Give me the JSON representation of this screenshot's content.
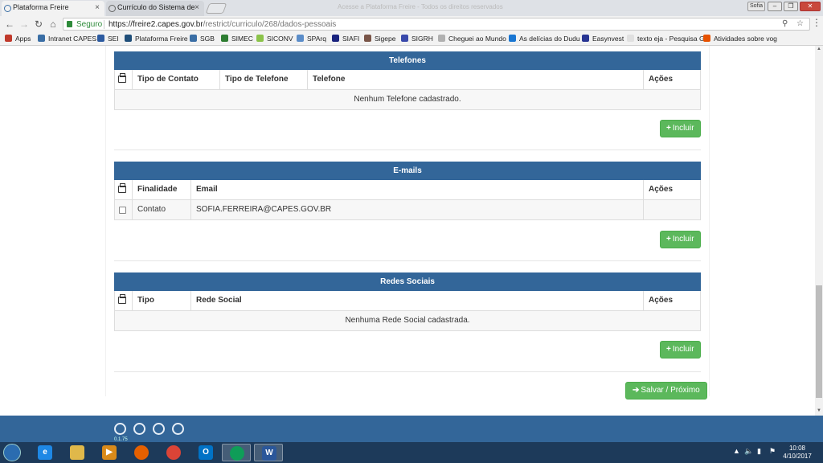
{
  "browser": {
    "tabs": [
      {
        "title": "Plataforma Freire",
        "active": true
      },
      {
        "title": "Currículo do Sistema de",
        "active": false
      }
    ],
    "faded_tab_text": "Acesse a Plataforma Freire - Todos os direitos reservados",
    "user_chip": "Sofia",
    "secure_label": "Seguro",
    "url_host": "https://freire2.capes.gov.br",
    "url_path": "/restrict/curriculo/268/dados-pessoais",
    "bookmarks": [
      {
        "label": "Apps",
        "color": "#c0392b"
      },
      {
        "label": "Intranet CAPES",
        "color": "#3a6ea5"
      },
      {
        "label": "SEI",
        "color": "#2c5aa0"
      },
      {
        "label": "Plataforma Freire",
        "color": "#1f4e79"
      },
      {
        "label": "SGB",
        "color": "#3a6ea5"
      },
      {
        "label": "SIMEC",
        "color": "#2e7d32"
      },
      {
        "label": "SICONV",
        "color": "#8bc34a"
      },
      {
        "label": "SPArq",
        "color": "#5b8dc9"
      },
      {
        "label": "SIAFI",
        "color": "#1a237e"
      },
      {
        "label": "Sigepe",
        "color": "#795548"
      },
      {
        "label": "SIGRH",
        "color": "#3949ab"
      },
      {
        "label": "Cheguei ao Mundo",
        "color": "#b0b0b0"
      },
      {
        "label": "As delícias do Dudu",
        "color": "#1976d2"
      },
      {
        "label": "Easynvest",
        "color": "#283593"
      },
      {
        "label": "texto eja - Pesquisa G",
        "color": "#e0e0e0"
      },
      {
        "label": "Atividades sobre vog",
        "color": "#e65100"
      }
    ]
  },
  "telefones": {
    "title": "Telefones",
    "columns": [
      "Tipo de Contato",
      "Tipo de Telefone",
      "Telefone",
      "Ações"
    ],
    "empty_message": "Nenhum Telefone cadastrado.",
    "add_label": "Incluir"
  },
  "emails": {
    "title": "E-mails",
    "columns": [
      "Finalidade",
      "Email",
      "Ações"
    ],
    "rows": [
      {
        "finalidade": "Contato",
        "email": "SOFIA.FERREIRA@CAPES.GOV.BR",
        "acoes": ""
      }
    ],
    "add_label": "Incluir"
  },
  "redes_sociais": {
    "title": "Redes Sociais",
    "columns": [
      "Tipo",
      "Rede Social",
      "Ações"
    ],
    "empty_message": "Nenhuma Rede Social cadastrada.",
    "add_label": "Incluir"
  },
  "actions": {
    "save_next_label": "Salvar / Próximo"
  },
  "footer": {
    "version": "0.1.75"
  },
  "taskbar": {
    "time": "10:08",
    "date": "4/10/2017"
  },
  "colors": {
    "panel_header": "#336699",
    "success_button": "#5cb85c"
  }
}
